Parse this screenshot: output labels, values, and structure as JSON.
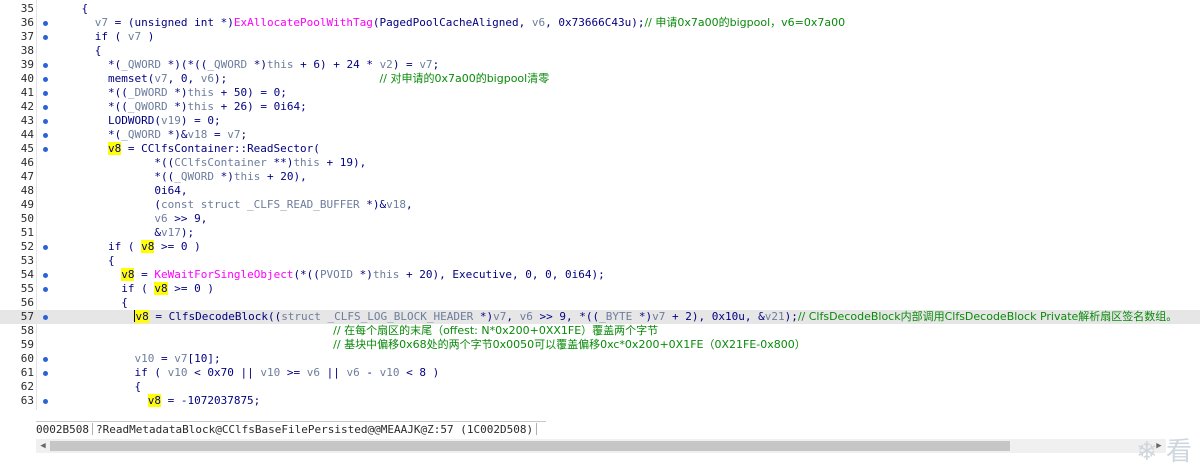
{
  "lines": [
    {
      "num": "35",
      "dot": false,
      "tokens": [
        {
          "t": "    {",
          "c": "p"
        }
      ]
    },
    {
      "num": "36",
      "dot": true,
      "tokens": [
        {
          "t": "      v7",
          "c": "v"
        },
        {
          "t": " = (unsigned int *)",
          "c": "p"
        },
        {
          "t": "ExAllocatePoolWithTag",
          "c": "f"
        },
        {
          "t": "(PagedPoolCacheAligned, ",
          "c": "p"
        },
        {
          "t": "v6",
          "c": "v"
        },
        {
          "t": ", 0x73666C43u);",
          "c": "p"
        },
        {
          "t": "// 申请0x7a00的bigpool，v6=0x7a00",
          "c": "g"
        }
      ]
    },
    {
      "num": "37",
      "dot": true,
      "tokens": [
        {
          "t": "      if ( ",
          "c": "p"
        },
        {
          "t": "v7",
          "c": "v"
        },
        {
          "t": " )",
          "c": "p"
        }
      ]
    },
    {
      "num": "38",
      "dot": false,
      "tokens": [
        {
          "t": "      {",
          "c": "p"
        }
      ]
    },
    {
      "num": "39",
      "dot": true,
      "tokens": [
        {
          "t": "        *(",
          "c": "p"
        },
        {
          "t": "_QWORD",
          "c": "v"
        },
        {
          "t": " *)(*((",
          "c": "p"
        },
        {
          "t": "_QWORD",
          "c": "v"
        },
        {
          "t": " *)",
          "c": "p"
        },
        {
          "t": "this",
          "c": "v"
        },
        {
          "t": " + 6) + 24 * ",
          "c": "p"
        },
        {
          "t": "v2",
          "c": "v"
        },
        {
          "t": ") = ",
          "c": "p"
        },
        {
          "t": "v7",
          "c": "v"
        },
        {
          "t": ";",
          "c": "p"
        }
      ]
    },
    {
      "num": "40",
      "dot": true,
      "tokens": [
        {
          "t": "        memset(",
          "c": "p"
        },
        {
          "t": "v7",
          "c": "v"
        },
        {
          "t": ", 0, ",
          "c": "p"
        },
        {
          "t": "v6",
          "c": "v"
        },
        {
          "t": ");                       ",
          "c": "p"
        },
        {
          "t": "// 对申请的0x7a00的bigpool清零",
          "c": "g"
        }
      ]
    },
    {
      "num": "41",
      "dot": true,
      "tokens": [
        {
          "t": "        *((",
          "c": "p"
        },
        {
          "t": "_DWORD",
          "c": "v"
        },
        {
          "t": " *)",
          "c": "p"
        },
        {
          "t": "this",
          "c": "v"
        },
        {
          "t": " + 50) = 0;",
          "c": "p"
        }
      ]
    },
    {
      "num": "42",
      "dot": true,
      "tokens": [
        {
          "t": "        *((",
          "c": "p"
        },
        {
          "t": "_QWORD",
          "c": "v"
        },
        {
          "t": " *)",
          "c": "p"
        },
        {
          "t": "this",
          "c": "v"
        },
        {
          "t": " + 26) = 0i64;",
          "c": "p"
        }
      ]
    },
    {
      "num": "43",
      "dot": true,
      "tokens": [
        {
          "t": "        LODWORD(",
          "c": "p"
        },
        {
          "t": "v19",
          "c": "v"
        },
        {
          "t": ") = 0;",
          "c": "p"
        }
      ]
    },
    {
      "num": "44",
      "dot": true,
      "tokens": [
        {
          "t": "        *(",
          "c": "p"
        },
        {
          "t": "_QWORD",
          "c": "v"
        },
        {
          "t": " *)&",
          "c": "p"
        },
        {
          "t": "v18",
          "c": "v"
        },
        {
          "t": " = ",
          "c": "p"
        },
        {
          "t": "v7",
          "c": "v"
        },
        {
          "t": ";",
          "c": "p"
        }
      ]
    },
    {
      "num": "45",
      "dot": true,
      "tokens": [
        {
          "t": "        ",
          "c": "p"
        },
        {
          "t": "v8",
          "c": "h"
        },
        {
          "t": " = CClfsContainer::ReadSector(",
          "c": "p"
        }
      ]
    },
    {
      "num": "46",
      "dot": false,
      "tokens": [
        {
          "t": "               *((",
          "c": "p"
        },
        {
          "t": "CClfsContainer",
          "c": "v"
        },
        {
          "t": " **)",
          "c": "p"
        },
        {
          "t": "this",
          "c": "v"
        },
        {
          "t": " + 19),",
          "c": "p"
        }
      ]
    },
    {
      "num": "47",
      "dot": false,
      "tokens": [
        {
          "t": "               *((",
          "c": "p"
        },
        {
          "t": "_QWORD",
          "c": "v"
        },
        {
          "t": " *)",
          "c": "p"
        },
        {
          "t": "this",
          "c": "v"
        },
        {
          "t": " + 20),",
          "c": "p"
        }
      ]
    },
    {
      "num": "48",
      "dot": false,
      "tokens": [
        {
          "t": "               0i64,",
          "c": "p"
        }
      ]
    },
    {
      "num": "49",
      "dot": false,
      "tokens": [
        {
          "t": "               (",
          "c": "p"
        },
        {
          "t": "const struct _CLFS_READ_BUFFER",
          "c": "v"
        },
        {
          "t": " *)&",
          "c": "p"
        },
        {
          "t": "v18",
          "c": "v"
        },
        {
          "t": ",",
          "c": "p"
        }
      ]
    },
    {
      "num": "50",
      "dot": false,
      "tokens": [
        {
          "t": "               ",
          "c": "p"
        },
        {
          "t": "v6",
          "c": "v"
        },
        {
          "t": " >> 9,",
          "c": "p"
        }
      ]
    },
    {
      "num": "51",
      "dot": false,
      "tokens": [
        {
          "t": "               &",
          "c": "p"
        },
        {
          "t": "v17",
          "c": "v"
        },
        {
          "t": ");",
          "c": "p"
        }
      ]
    },
    {
      "num": "52",
      "dot": true,
      "tokens": [
        {
          "t": "        if ( ",
          "c": "p"
        },
        {
          "t": "v8",
          "c": "h"
        },
        {
          "t": " >= 0 )",
          "c": "p"
        }
      ]
    },
    {
      "num": "53",
      "dot": false,
      "tokens": [
        {
          "t": "        {",
          "c": "p"
        }
      ]
    },
    {
      "num": "54",
      "dot": true,
      "tokens": [
        {
          "t": "          ",
          "c": "p"
        },
        {
          "t": "v8",
          "c": "h"
        },
        {
          "t": " = ",
          "c": "p"
        },
        {
          "t": "KeWaitForSingleObject",
          "c": "f"
        },
        {
          "t": "(*((",
          "c": "p"
        },
        {
          "t": "PVOID",
          "c": "v"
        },
        {
          "t": " *)",
          "c": "p"
        },
        {
          "t": "this",
          "c": "v"
        },
        {
          "t": " + 20), Executive, 0, 0, 0i64);",
          "c": "p"
        }
      ]
    },
    {
      "num": "55",
      "dot": true,
      "tokens": [
        {
          "t": "          if ( ",
          "c": "p"
        },
        {
          "t": "v8",
          "c": "h"
        },
        {
          "t": " >= 0 )",
          "c": "p"
        }
      ]
    },
    {
      "num": "56",
      "dot": false,
      "tokens": [
        {
          "t": "          {",
          "c": "p"
        }
      ]
    },
    {
      "num": "57",
      "dot": true,
      "current": true,
      "tokens": [
        {
          "t": "            ",
          "c": "p"
        },
        {
          "t": "v8",
          "c": "h"
        },
        {
          "t": " = ClfsDecodeBlock((",
          "c": "p"
        },
        {
          "t": "struct _CLFS_LOG_BLOCK_HEADER",
          "c": "v"
        },
        {
          "t": " *)",
          "c": "p"
        },
        {
          "t": "v7",
          "c": "v"
        },
        {
          "t": ", ",
          "c": "p"
        },
        {
          "t": "v6",
          "c": "v"
        },
        {
          "t": " >> 9, *((",
          "c": "p"
        },
        {
          "t": "_BYTE",
          "c": "v"
        },
        {
          "t": " *)",
          "c": "p"
        },
        {
          "t": "v7",
          "c": "v"
        },
        {
          "t": " + 2), 0x10u, &",
          "c": "p"
        },
        {
          "t": "v21",
          "c": "v"
        },
        {
          "t": ");",
          "c": "p"
        },
        {
          "t": "// ClfsDecodeBlock内部调用ClfsDecodeBlock Private解析扇区签名数组。",
          "c": "g"
        }
      ]
    },
    {
      "num": "58",
      "dot": false,
      "tokens": [
        {
          "t": "                                          ",
          "c": "p"
        },
        {
          "t": "// 在每个扇区的末尾（offest: N*0x200+0XX1FE）覆盖两个字节",
          "c": "g"
        }
      ]
    },
    {
      "num": "59",
      "dot": false,
      "tokens": [
        {
          "t": "                                          ",
          "c": "p"
        },
        {
          "t": "// 基块中偏移0x68处的两个字节0x0050可以覆盖偏移0xc*0x200+0X1FE（0X21FE-0x800）",
          "c": "g"
        }
      ]
    },
    {
      "num": "60",
      "dot": true,
      "tokens": [
        {
          "t": "            ",
          "c": "p"
        },
        {
          "t": "v10",
          "c": "v"
        },
        {
          "t": " = ",
          "c": "p"
        },
        {
          "t": "v7",
          "c": "v"
        },
        {
          "t": "[10];",
          "c": "p"
        }
      ]
    },
    {
      "num": "61",
      "dot": true,
      "tokens": [
        {
          "t": "            if ( ",
          "c": "p"
        },
        {
          "t": "v10",
          "c": "v"
        },
        {
          "t": " < 0x70 || ",
          "c": "p"
        },
        {
          "t": "v10",
          "c": "v"
        },
        {
          "t": " >= ",
          "c": "p"
        },
        {
          "t": "v6",
          "c": "v"
        },
        {
          "t": " || ",
          "c": "p"
        },
        {
          "t": "v6",
          "c": "v"
        },
        {
          "t": " - ",
          "c": "p"
        },
        {
          "t": "v10",
          "c": "v"
        },
        {
          "t": " < 8 )",
          "c": "p"
        }
      ]
    },
    {
      "num": "62",
      "dot": false,
      "tokens": [
        {
          "t": "            {",
          "c": "p"
        }
      ]
    },
    {
      "num": "63",
      "dot": true,
      "tokens": [
        {
          "t": "              ",
          "c": "p"
        },
        {
          "t": "v8",
          "c": "h"
        },
        {
          "t": " = -1072037875;",
          "c": "p"
        }
      ]
    }
  ],
  "status": {
    "address": "0002B508",
    "function": "?ReadMetadataBlock@CClfsBaseFilePersisted@@MEAAJK@Z:57",
    "ea": "(1C002D508)"
  },
  "watermark": "❄ 看"
}
